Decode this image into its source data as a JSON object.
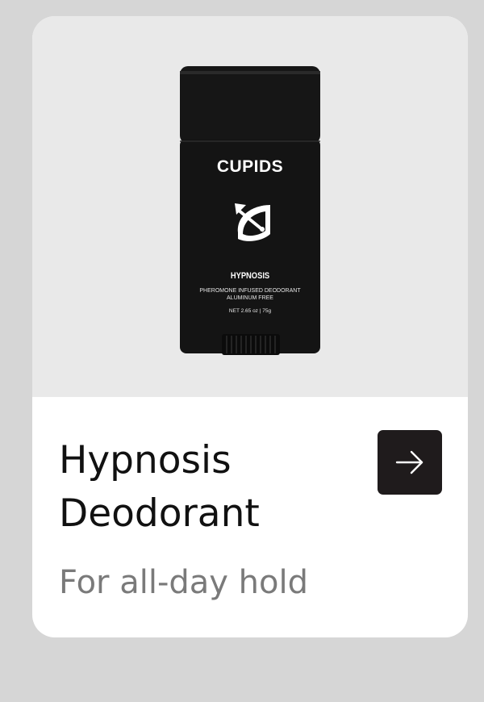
{
  "product": {
    "brand_label": "CUPIDS",
    "variant_label": "HYPNOSIS",
    "tagline_line1": "PHEROMONE INFUSED DEODORANT",
    "tagline_line2": "ALUMINUM FREE",
    "net_weight": "NET 2.65 oz | 75g",
    "image_icon": "bow-and-arrow-logo"
  },
  "card": {
    "title": "Hypnosis Deodorant",
    "subtitle": "For all-day hold",
    "action_icon": "arrow-right-icon"
  },
  "colors": {
    "page_background": "#d6d6d6",
    "image_background": "#e9e9e9",
    "button_background": "#1f1b1c",
    "subtitle_text": "#7a7a7a"
  }
}
